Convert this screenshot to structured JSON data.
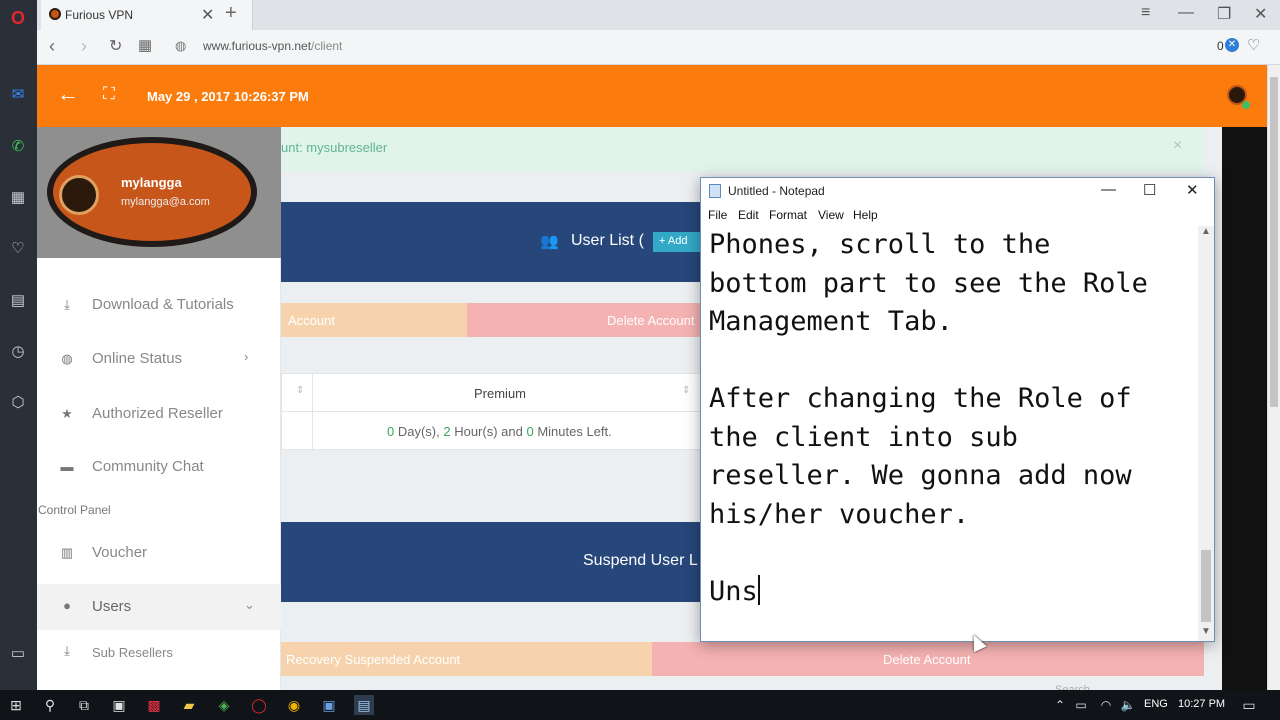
{
  "browser": {
    "tab_title": "Furious VPN",
    "url_host": "www.furious-vpn.net",
    "url_path": "/client",
    "block_count": "0"
  },
  "site": {
    "header_datetime": "May 29 , 2017 10:26:37 PM",
    "alert_text": "unt: mysubreseller",
    "user_list_title": "User List (",
    "add_button": "Add",
    "row1_left_button": "Account",
    "row1_right_button": "Delete Account",
    "table_header": "Premium",
    "time_left": {
      "days": "0",
      "days_suffix": " Day(s), ",
      "hours": "2",
      "hours_suffix": " Hour(s) and ",
      "minutes": "0",
      "minutes_suffix": " Minutes Left."
    },
    "suspend_title": "Suspend User L",
    "row2_left_button": "Recovery Suspended Account",
    "row2_right_button": "Delete Account",
    "search_placeholder": "Search"
  },
  "sidebar": {
    "username": "mylangga",
    "email": "mylangga@a.com",
    "items": [
      {
        "label": "Download & Tutorials",
        "icon": "download-icon"
      },
      {
        "label": "Online Status",
        "icon": "globe-icon"
      },
      {
        "label": "Authorized Reseller",
        "icon": "star-icon"
      },
      {
        "label": "Community Chat",
        "icon": "chat-icon"
      }
    ],
    "section_label": "Control Panel",
    "cp_items": [
      {
        "label": "Voucher",
        "icon": "barcode-icon"
      },
      {
        "label": "Users",
        "icon": "user-icon"
      },
      {
        "label": "Sub Resellers",
        "icon": "sub-resellers-icon"
      }
    ]
  },
  "notepad": {
    "title": "Untitled - Notepad",
    "menu": [
      "File",
      "Edit",
      "Format",
      "View",
      "Help"
    ],
    "text": "Phones, scroll to the\nbottom part to see the Role\nManagement Tab.\n\nAfter changing the Role of\nthe client into sub\nreseller. We gonna add now\nhis/her voucher.\n\nUns"
  },
  "taskbar": {
    "language": "ENG",
    "time": "10:27 PM"
  },
  "colors": {
    "header_orange": "#fb7b0c",
    "navy": "#27467a",
    "peach": "#f6d3ad",
    "pink": "#f5b2b2",
    "green_text": "#3aa55a"
  }
}
